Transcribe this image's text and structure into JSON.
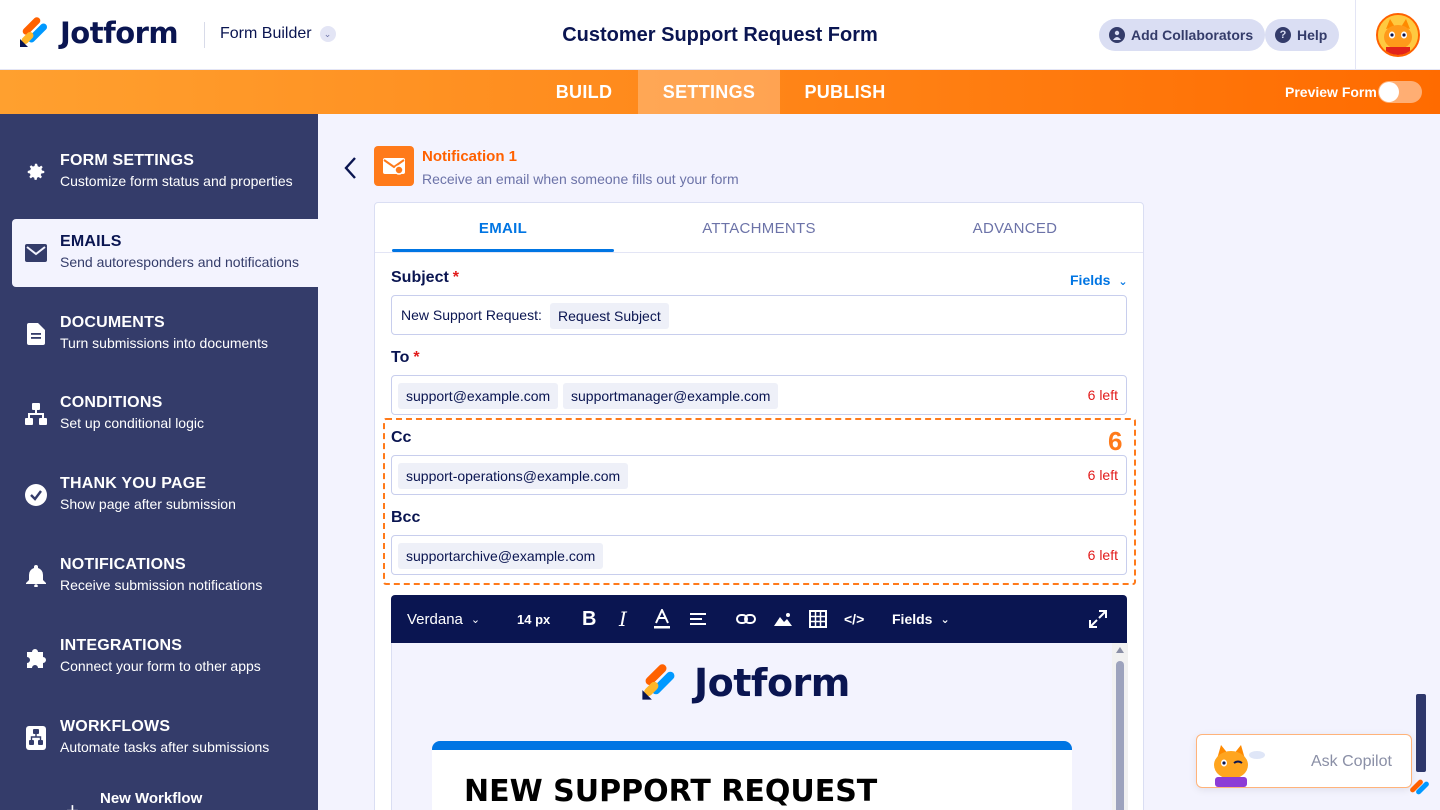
{
  "header": {
    "logo_text": "Jotform",
    "builder_label": "Form Builder",
    "form_title": "Customer Support Request Form",
    "add_collaborators": "Add Collaborators",
    "help": "Help"
  },
  "nav": {
    "tabs": [
      "BUILD",
      "SETTINGS",
      "PUBLISH"
    ],
    "active_tab": "SETTINGS",
    "preview_label": "Preview Form",
    "preview_on": false
  },
  "sidebar": {
    "items": [
      {
        "title": "FORM SETTINGS",
        "desc": "Customize form status and properties",
        "icon": "gear-icon"
      },
      {
        "title": "EMAILS",
        "desc": "Send autoresponders and notifications",
        "icon": "envelope-icon",
        "active": true
      },
      {
        "title": "DOCUMENTS",
        "desc": "Turn submissions into documents",
        "icon": "document-icon"
      },
      {
        "title": "CONDITIONS",
        "desc": "Set up conditional logic",
        "icon": "conditions-icon"
      },
      {
        "title": "THANK YOU PAGE",
        "desc": "Show page after submission",
        "icon": "checkmark-icon"
      },
      {
        "title": "NOTIFICATIONS",
        "desc": "Receive submission notifications",
        "icon": "bell-icon"
      },
      {
        "title": "INTEGRATIONS",
        "desc": "Connect your form to other apps",
        "icon": "puzzle-icon"
      },
      {
        "title": "WORKFLOWS",
        "desc": "Automate tasks after submissions",
        "icon": "workflow-icon"
      }
    ],
    "new_workflow": "New Workflow"
  },
  "notification": {
    "title": "Notification 1",
    "subtitle": "Receive an email when someone fills out your form"
  },
  "tabs": [
    "EMAIL",
    "ATTACHMENTS",
    "ADVANCED"
  ],
  "form": {
    "subject_label": "Subject",
    "fields_link": "Fields",
    "subject_prefix": "New Support Request:",
    "subject_tag": "Request Subject",
    "to_label": "To",
    "to_emails": [
      "support@example.com",
      "supportmanager@example.com"
    ],
    "to_left": "6 left",
    "cc_label": "Cc",
    "cc_emails": [
      "support-operations@example.com"
    ],
    "cc_left": "6 left",
    "bcc_label": "Bcc",
    "bcc_emails": [
      "supportarchive@example.com"
    ],
    "bcc_left": "6 left",
    "annotation_number": "6"
  },
  "editor": {
    "font": "Verdana",
    "size": "14 px",
    "fields": "Fields",
    "logo_text": "Jotform",
    "heading": "NEW SUPPORT REQUEST"
  },
  "copilot": {
    "label": "Ask Copilot"
  },
  "colors": {
    "accent_orange": "#ff6100",
    "primary_blue": "#0075e3",
    "navy": "#0a1551",
    "sidebar_bg": "#343c6a",
    "required_red": "#e21b1b"
  }
}
